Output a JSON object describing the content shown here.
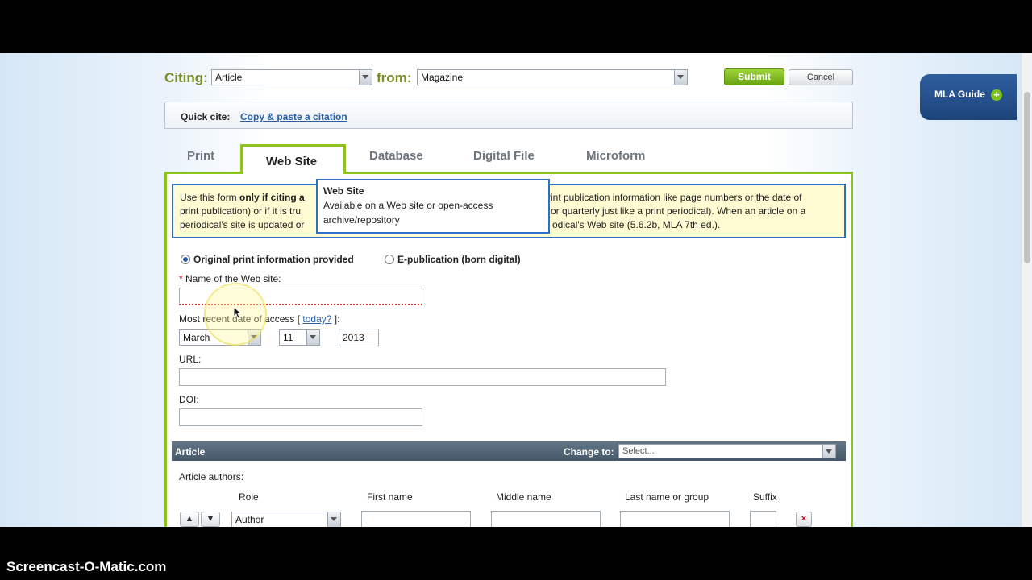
{
  "citing": {
    "label": "Citing:",
    "value": "Article",
    "from_label": "from:",
    "from_value": "Magazine"
  },
  "actions": {
    "submit": "Submit",
    "cancel": "Cancel"
  },
  "mla_guide": {
    "label": "MLA Guide"
  },
  "quick_cite": {
    "label": "Quick cite:",
    "link": "Copy & paste a citation"
  },
  "tabs": [
    {
      "label": "Print"
    },
    {
      "label": "Web Site"
    },
    {
      "label": "Database"
    },
    {
      "label": "Digital File"
    },
    {
      "label": "Microform"
    }
  ],
  "notice": {
    "line1_pre": "Use this form ",
    "line1_bold": "only if citing a",
    "line1_post": "rint publication information like page numbers or the date of",
    "line2_pre": "print publication) or if it is tru",
    "line2_post": "or quarterly just like a print periodical). When an article on a",
    "line3_pre": "periodical's site is updated or",
    "line3_post": "odical's Web site (5.6.2b, MLA 7th ed.)."
  },
  "tooltip": {
    "title": "Web Site",
    "body": "Available on a Web site or open-access archive/repository"
  },
  "radios": {
    "option1": "Original print information provided",
    "option2": "E-publication (born digital)"
  },
  "website_name": {
    "required_mark": "*",
    "label": "Name of the Web site:"
  },
  "access_date": {
    "label_pre": "Most recent date of access [ ",
    "today_link": "today?",
    "label_post": " ]:",
    "month": "March",
    "day": "11",
    "year": "2013"
  },
  "url": {
    "label": "URL:"
  },
  "doi": {
    "label": "DOI:"
  },
  "article_section": {
    "title": "Article",
    "change_to_label": "Change to:",
    "change_to_value": "Select..."
  },
  "authors": {
    "label": "Article authors:",
    "columns": [
      "Role",
      "First name",
      "Middle name",
      "Last name or group",
      "Suffix"
    ],
    "role_value": "Author"
  },
  "watermark": "Screencast-O-Matic.com",
  "colors": {
    "accent_green": "#8fc31f",
    "header_bar": "#4f6373",
    "tooltip_border": "#2a6fc9",
    "notice_bg": "#fffbd2"
  }
}
